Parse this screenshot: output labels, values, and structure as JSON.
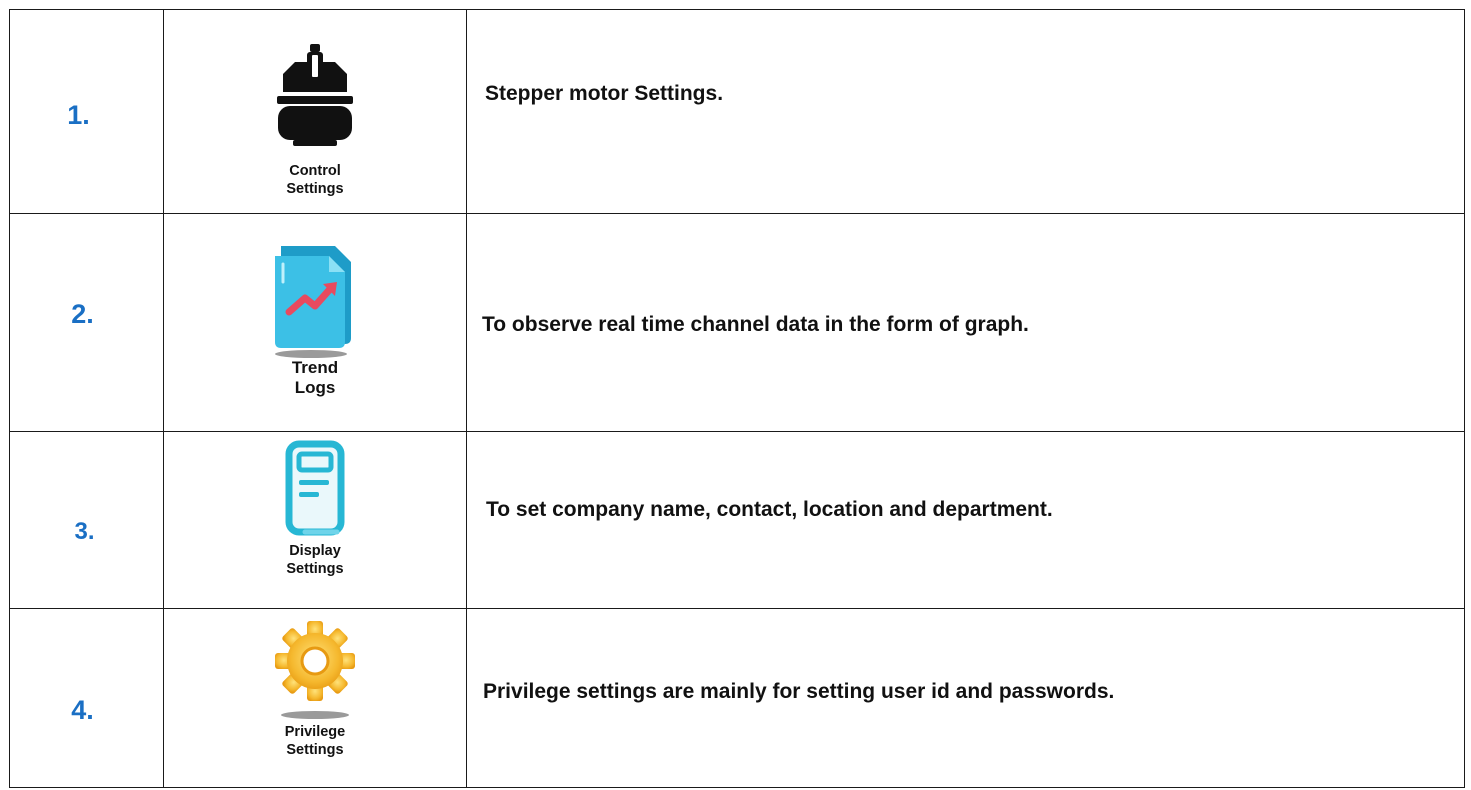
{
  "rows": [
    {
      "number": "1.",
      "icon": "stepper-motor-icon",
      "caption": [
        "Control",
        "Settings"
      ],
      "description": "Stepper motor Settings."
    },
    {
      "number": "2.",
      "icon": "trend-chart-document-icon",
      "caption": [
        "Trend",
        "Logs"
      ],
      "description": "To observe real time channel data in the form of graph."
    },
    {
      "number": "3.",
      "icon": "display-document-icon",
      "caption": [
        "Display",
        "Settings"
      ],
      "description": "To set company name, contact, location and department."
    },
    {
      "number": "4.",
      "icon": "gear-icon",
      "caption": [
        "Privilege",
        "Settings"
      ],
      "description": "Privilege settings are mainly for setting user id and passwords."
    }
  ],
  "colors": {
    "number": "#1a6fc4",
    "text": "#111111",
    "border": "#1a1a1a",
    "trend_doc": "#3cc0e6",
    "trend_arrow": "#e84a5f",
    "display_doc": "#27b7d4",
    "gear": "#f5b82e"
  }
}
